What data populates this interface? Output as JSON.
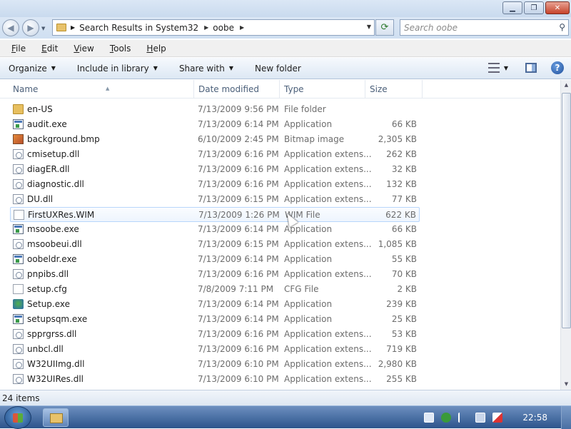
{
  "window": {
    "controls": {
      "minimize": "▁",
      "maximize": "❐",
      "close": "✕"
    }
  },
  "address": {
    "crumbs": [
      "Search Results in System32",
      "oobe"
    ],
    "search_placeholder": "Search oobe"
  },
  "menubar": {
    "items": [
      {
        "first": "F",
        "rest": "ile"
      },
      {
        "first": "E",
        "rest": "dit"
      },
      {
        "first": "V",
        "rest": "iew"
      },
      {
        "first": "T",
        "rest": "ools"
      },
      {
        "first": "H",
        "rest": "elp"
      }
    ]
  },
  "commandbar": {
    "organize": "Organize",
    "include": "Include in library",
    "share": "Share with",
    "newfolder": "New folder",
    "help": "?"
  },
  "columns": {
    "name": "Name",
    "date": "Date modified",
    "type": "Type",
    "size": "Size"
  },
  "files": [
    {
      "name": "en-US",
      "date": "7/13/2009 9:56 PM",
      "type": "File folder",
      "size": "",
      "icon": "folder-icon"
    },
    {
      "name": "audit.exe",
      "date": "7/13/2009 6:14 PM",
      "type": "Application",
      "size": "66 KB",
      "icon": "exe-icon"
    },
    {
      "name": "background.bmp",
      "date": "6/10/2009 2:45 PM",
      "type": "Bitmap image",
      "size": "2,305 KB",
      "icon": "bitmap-icon"
    },
    {
      "name": "cmisetup.dll",
      "date": "7/13/2009 6:16 PM",
      "type": "Application extens...",
      "size": "262 KB",
      "icon": "dll-icon"
    },
    {
      "name": "diagER.dll",
      "date": "7/13/2009 6:16 PM",
      "type": "Application extens...",
      "size": "32 KB",
      "icon": "dll-icon"
    },
    {
      "name": "diagnostic.dll",
      "date": "7/13/2009 6:16 PM",
      "type": "Application extens...",
      "size": "132 KB",
      "icon": "dll-icon"
    },
    {
      "name": "DU.dll",
      "date": "7/13/2009 6:15 PM",
      "type": "Application extens...",
      "size": "77 KB",
      "icon": "dll-icon"
    },
    {
      "name": "FirstUXRes.WIM",
      "date": "7/13/2009 1:26 PM",
      "type": "WIM File",
      "size": "622 KB",
      "icon": "file-icon"
    },
    {
      "name": "msoobe.exe",
      "date": "7/13/2009 6:14 PM",
      "type": "Application",
      "size": "66 KB",
      "icon": "exe-icon"
    },
    {
      "name": "msoobeui.dll",
      "date": "7/13/2009 6:15 PM",
      "type": "Application extens...",
      "size": "1,085 KB",
      "icon": "dll-icon"
    },
    {
      "name": "oobeldr.exe",
      "date": "7/13/2009 6:14 PM",
      "type": "Application",
      "size": "55 KB",
      "icon": "exe-icon"
    },
    {
      "name": "pnpibs.dll",
      "date": "7/13/2009 6:16 PM",
      "type": "Application extens...",
      "size": "70 KB",
      "icon": "dll-icon"
    },
    {
      "name": "setup.cfg",
      "date": "7/8/2009 7:11 PM",
      "type": "CFG File",
      "size": "2 KB",
      "icon": "file-icon"
    },
    {
      "name": "Setup.exe",
      "date": "7/13/2009 6:14 PM",
      "type": "Application",
      "size": "239 KB",
      "icon": "setup-icon"
    },
    {
      "name": "setupsqm.exe",
      "date": "7/13/2009 6:14 PM",
      "type": "Application",
      "size": "25 KB",
      "icon": "exe-icon"
    },
    {
      "name": "spprgrss.dll",
      "date": "7/13/2009 6:16 PM",
      "type": "Application extens...",
      "size": "53 KB",
      "icon": "dll-icon"
    },
    {
      "name": "unbcl.dll",
      "date": "7/13/2009 6:16 PM",
      "type": "Application extens...",
      "size": "719 KB",
      "icon": "dll-icon"
    },
    {
      "name": "W32UIImg.dll",
      "date": "7/13/2009 6:10 PM",
      "type": "Application extens...",
      "size": "2,980 KB",
      "icon": "dll-icon"
    },
    {
      "name": "W32UIRes.dll",
      "date": "7/13/2009 6:10 PM",
      "type": "Application extens...",
      "size": "255 KB",
      "icon": "dll-icon"
    }
  ],
  "hover_row": 7,
  "status": {
    "count": "24 items"
  },
  "taskbar": {
    "clock": "22:58"
  }
}
